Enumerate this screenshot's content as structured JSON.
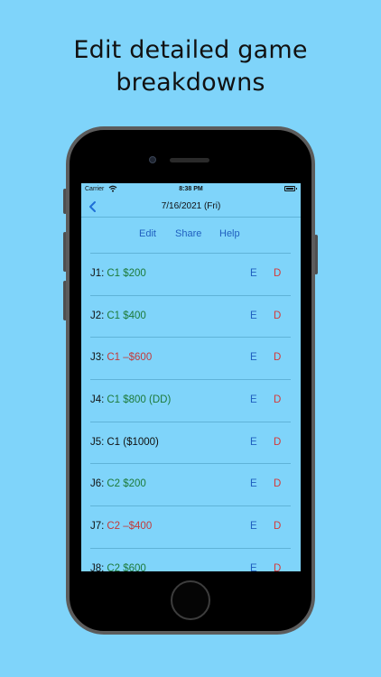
{
  "headline": [
    "Edit detailed game",
    "breakdowns"
  ],
  "status_bar": {
    "carrier": "Carrier",
    "time": "8:38 PM"
  },
  "nav": {
    "title": "7/16/2021 (Fri)"
  },
  "toolbar": {
    "edit": "Edit",
    "share": "Share",
    "help": "Help"
  },
  "row_actions": {
    "edit": "E",
    "delete": "D"
  },
  "rows": [
    {
      "label": "J1:",
      "value": "C1 $200",
      "color": "green"
    },
    {
      "label": "J2:",
      "value": "C1 $400",
      "color": "green"
    },
    {
      "label": "J3:",
      "value": "C1 –$600",
      "color": "red"
    },
    {
      "label": "J4:",
      "value": "C1 $800 (DD)",
      "color": "green"
    },
    {
      "label": "J5:",
      "value": "C1 ($1000)",
      "color": "black"
    },
    {
      "label": "J6:",
      "value": "C2 $200",
      "color": "green"
    },
    {
      "label": "J7:",
      "value": "C2 –$400",
      "color": "red"
    },
    {
      "label": "J8:",
      "value": "C2 $600",
      "color": "green"
    }
  ],
  "colors": {
    "background": "#7fd4fa",
    "accent": "#1f5fbf",
    "positive": "#1d7a3a",
    "negative": "#c33a3a",
    "delete": "#d43a3a"
  }
}
